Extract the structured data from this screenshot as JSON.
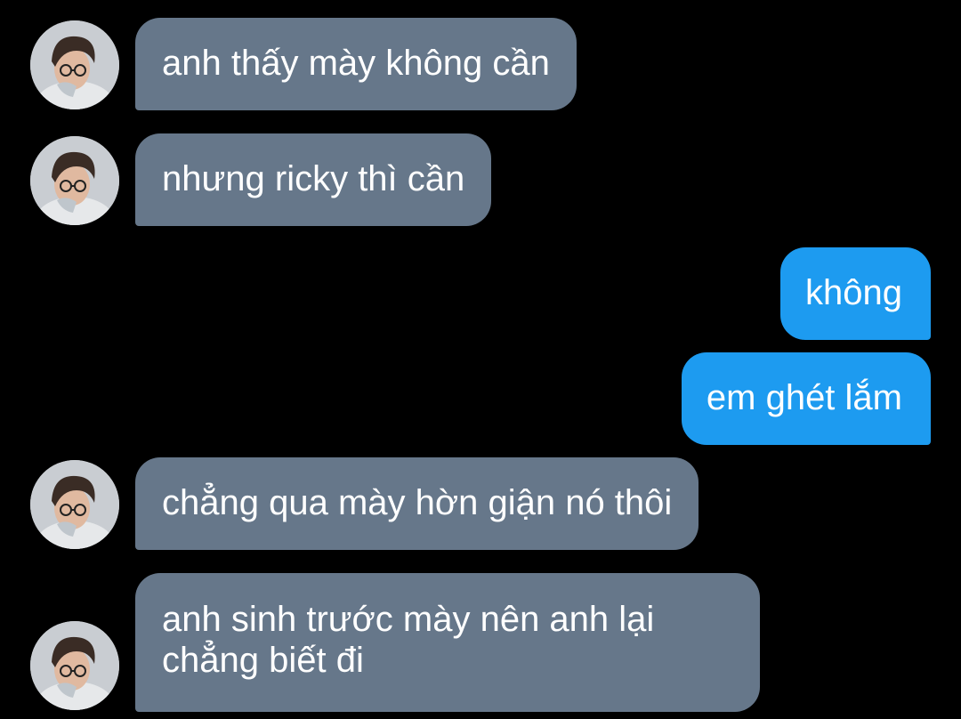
{
  "conversation": {
    "messages": [
      {
        "sender": "contact",
        "text": "anh thấy mày không cần"
      },
      {
        "sender": "contact",
        "text": "nhưng ricky thì cần"
      },
      {
        "sender": "me",
        "text": "không"
      },
      {
        "sender": "me",
        "text": "em ghét lắm"
      },
      {
        "sender": "contact",
        "text": "chẳng qua mày hờn giận nó thôi"
      },
      {
        "sender": "contact",
        "text": "anh sinh trước mày nên anh lại chẳng biết đi"
      }
    ]
  },
  "colors": {
    "background": "#000000",
    "incoming_bubble": "#66778a",
    "outgoing_bubble": "#1d9bf0",
    "text": "#ffffff"
  },
  "icons": {
    "contact_avatar": "contact-avatar-photo"
  }
}
